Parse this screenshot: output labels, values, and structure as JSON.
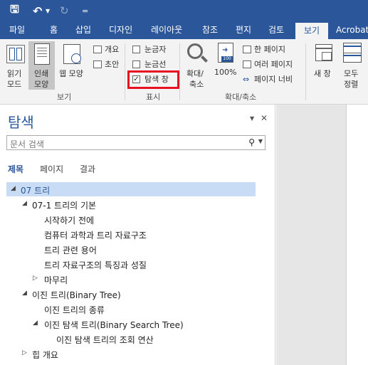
{
  "quick_access": {
    "save_icon": "save-icon",
    "undo_icon": "undo-icon",
    "redo_icon": "redo-icon",
    "more": "="
  },
  "tabs": [
    "파일",
    "홈",
    "삽입",
    "디자인",
    "레이아웃",
    "참조",
    "편지",
    "검토",
    "보기",
    "Acrobat"
  ],
  "active_tab": "보기",
  "ribbon": {
    "views": {
      "read_mode": [
        "읽기",
        "모드"
      ],
      "print_layout": [
        "인쇄",
        "모양"
      ],
      "web_layout": "웹 모양",
      "outline": "개요",
      "draft": "초안",
      "group_label": "보기"
    },
    "show": {
      "ruler": "눈금자",
      "gridlines": "눈금선",
      "navigation_pane": "탐색 창",
      "navigation_pane_checked": "✓",
      "group_label": "표시"
    },
    "zoom": {
      "zoom": [
        "확대/",
        "축소"
      ],
      "hundred": "100%",
      "hundred_icon_text": "100",
      "one_page": "한 페이지",
      "multiple_pages": "여러 페이지",
      "page_width": "페이지 너비",
      "group_label": "확대/축소"
    },
    "window": {
      "new_window": "새 창",
      "arrange_all": [
        "모두",
        "정렬"
      ]
    }
  },
  "nav_pane": {
    "title": "탐색",
    "dropdown": "▼",
    "close": "✕",
    "search_placeholder": "문서 검색",
    "search_icon": "⚲",
    "search_arrow": "▼",
    "tabs": [
      "제목",
      "페이지",
      "결과"
    ],
    "tree": [
      {
        "text": "07 트리",
        "arrow": "◢",
        "selected": true
      },
      {
        "text": "07-1 트리의 기본",
        "arrow": "◢"
      },
      {
        "text": "시작하기 전에",
        "arrow": ""
      },
      {
        "text": "컴퓨터 과학과 트리 자료구조",
        "arrow": ""
      },
      {
        "text": "트리 관련 용어",
        "arrow": ""
      },
      {
        "text": "트리 자료구조의 특징과 성질",
        "arrow": ""
      },
      {
        "text": "마무리",
        "arrow": "▷"
      },
      {
        "text": "이진 트리(Binary Tree)",
        "arrow": "◢"
      },
      {
        "text": "이진 트리의 종류",
        "arrow": ""
      },
      {
        "text": "이진 탐색 트리(Binary Search Tree)",
        "arrow": "◢"
      },
      {
        "text": "이진 탐색 트리의 조회 연산",
        "arrow": ""
      },
      {
        "text": "힙 개요",
        "arrow": "▷"
      }
    ]
  },
  "colors": {
    "accent": "#2b579a",
    "highlight": "#e81123",
    "selection": "#c9dcf5"
  }
}
